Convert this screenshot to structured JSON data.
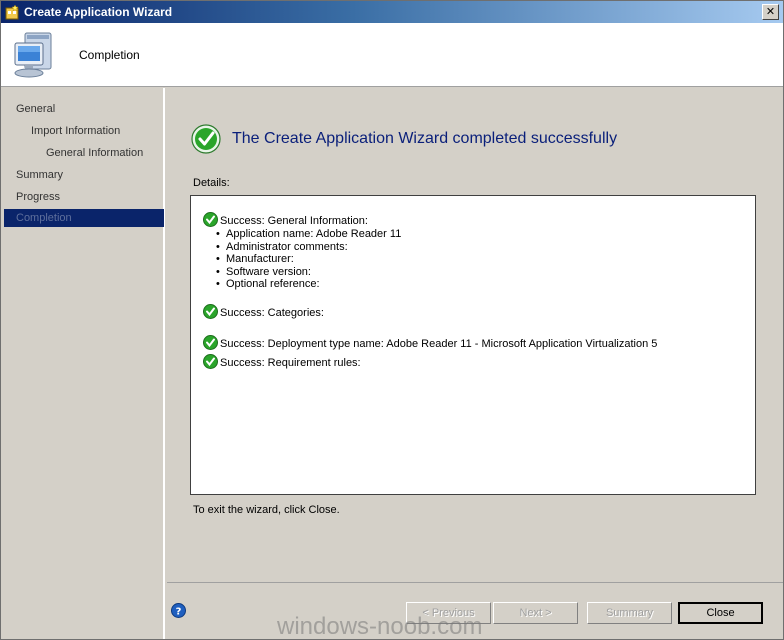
{
  "window": {
    "title": "Create Application Wizard",
    "close_glyph": "✕"
  },
  "header": {
    "title": "Completion",
    "icon": "computer-icon"
  },
  "sidebar": {
    "items": [
      {
        "label": "General",
        "level": 0,
        "active": false
      },
      {
        "label": "Import Information",
        "level": 1,
        "active": false
      },
      {
        "label": "General Information",
        "level": 2,
        "active": false
      },
      {
        "label": "Summary",
        "level": 0,
        "active": false
      },
      {
        "label": "Progress",
        "level": 0,
        "active": false
      },
      {
        "label": "Completion",
        "level": 0,
        "active": true
      }
    ]
  },
  "main": {
    "heading": "The Create Application Wizard completed successfully",
    "details_label": "Details:",
    "entries": [
      {
        "text": "Success: General Information:",
        "bullets": [
          "Application name: Adobe Reader 11",
          "Administrator comments:",
          "Manufacturer:",
          "Software version:",
          "Optional reference:"
        ]
      },
      {
        "text": "Success: Categories:"
      },
      {
        "text": "Success: Deployment type name: Adobe Reader 11 - Microsoft Application Virtualization 5"
      },
      {
        "text": "Success: Requirement rules:"
      }
    ],
    "exit_text": "To exit the wizard, click Close."
  },
  "footer": {
    "previous_label": "< Previous",
    "next_label": "Next >",
    "summary_label": "Summary",
    "close_label": "Close"
  },
  "watermark": "windows-noob.com",
  "colors": {
    "accent": "#0a246a",
    "heading": "#0a1f7a",
    "success": "#2aa52a"
  }
}
